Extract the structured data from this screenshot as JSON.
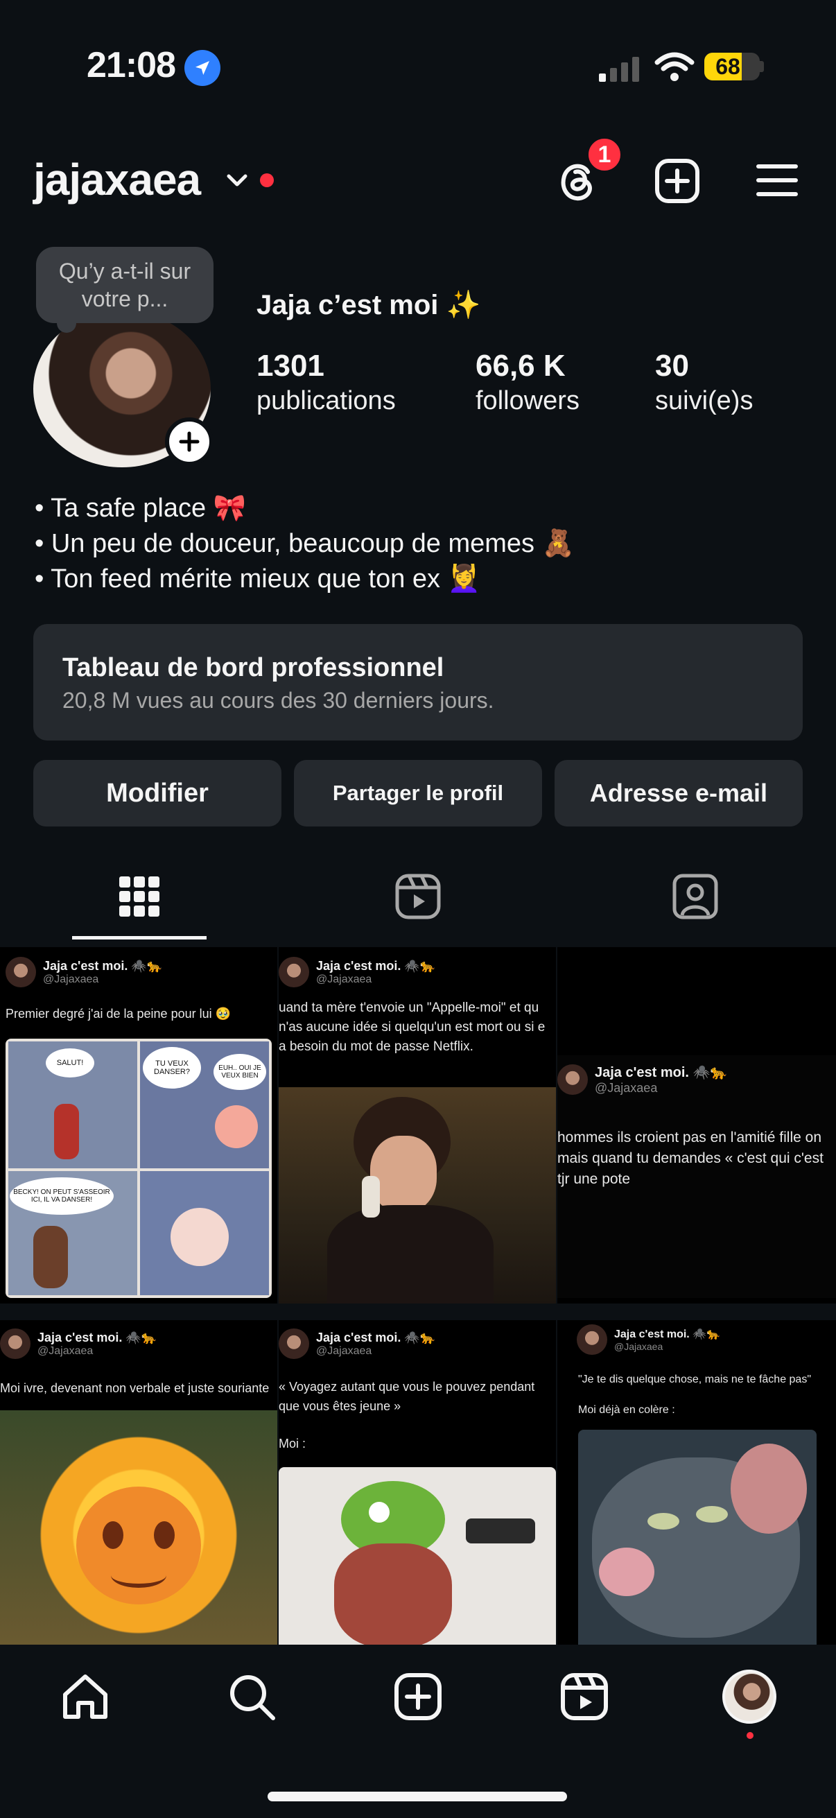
{
  "status_bar": {
    "time": "21:08",
    "battery": "68",
    "battery_level": 0.68
  },
  "header": {
    "username": "jajaxaea",
    "threads_badge": "1"
  },
  "profile": {
    "note_bubble": "Qu’y a-t-il sur votre p...",
    "display_name": "Jaja c’est moi ✨",
    "stats": [
      {
        "value": "1301",
        "label": "publications"
      },
      {
        "value": "66,6 K",
        "label": "followers"
      },
      {
        "value": "30",
        "label": "suivi(e)s"
      }
    ],
    "bio": [
      "• Ta safe place 🎀",
      "• Un peu de douceur, beaucoup de memes 🧸",
      "• Ton feed mérite mieux que ton ex 💆‍♀️"
    ]
  },
  "dashboard": {
    "title": "Tableau de bord professionnel",
    "subtitle": "20,8 M vues au cours des 30 derniers jours."
  },
  "buttons": {
    "edit": "Modifier",
    "share": "Partager le profil",
    "email": "Adresse e-mail"
  },
  "posts": [
    {
      "name": "Jaja c'est moi. 🕷️🐆",
      "handle": "@Jajaxaea",
      "text": "Premier degré j'ai de la peine pour lui 🥹",
      "comic": [
        "SALUT!",
        "TU VEUX DANSER?",
        "EUH.. OUI JE VEUX BIEN",
        "BECKY! ON PEUT S'ASSEOIR ICI, IL VA DANSER!"
      ]
    },
    {
      "name": "Jaja c'est moi. 🕷️🐆",
      "handle": "@Jajaxaea",
      "text": "uand ta mère t'envoie un \"Appelle-moi\" et qu n'as aucune idée si quelqu'un est mort ou si e a besoin du mot de passe Netflix."
    },
    {
      "name": "Jaja c'est moi. 🕷️🐆",
      "handle": "@Jajaxaea",
      "text": "hommes ils croient pas en l'amitié fille on mais quand tu demandes « c'est qui c'est tjr une pote"
    },
    {
      "name": "Jaja c'est moi. 🕷️🐆",
      "handle": "@Jajaxaea",
      "text": "Moi ivre, devenant non verbale et juste souriante"
    },
    {
      "name": "Jaja c'est moi. 🕷️🐆",
      "handle": "@Jajaxaea",
      "text": "« Voyagez autant que vous le pouvez pendant que vous êtes jeune »",
      "text2": "Moi :"
    },
    {
      "name": "Jaja c'est moi. 🕷️🐆",
      "handle": "@Jajaxaea",
      "text": "\"Je te dis quelque chose, mais ne te fâche pas\"",
      "text2": "Moi déjà en colère :"
    }
  ],
  "icons": {
    "location": "location-arrow-icon",
    "signal": "cellular-signal-icon",
    "wifi": "wifi-icon",
    "threads": "threads-icon",
    "new_post": "plus-square-icon",
    "menu": "hamburger-menu-icon",
    "grid_tab": "grid-icon",
    "reels_tab": "reels-icon",
    "tagged_tab": "tagged-person-icon",
    "nav_home": "home-icon",
    "nav_search": "search-icon",
    "nav_create": "plus-square-icon",
    "nav_reels": "reels-icon"
  },
  "colors": {
    "background": "#0c1014",
    "accent_red": "#ff3040",
    "card": "#25292e",
    "location_blue": "#2f80ff",
    "battery_yellow": "#ffd60a"
  }
}
